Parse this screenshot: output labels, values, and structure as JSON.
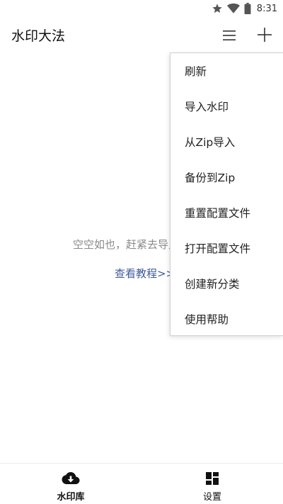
{
  "status_bar": {
    "time": "8:31",
    "icons": [
      "star-icon",
      "wifi-icon",
      "battery-icon"
    ]
  },
  "app_bar": {
    "title": "水印大法",
    "menu_icon": "list-menu-icon",
    "add_icon": "plus-icon"
  },
  "empty_state": {
    "message": "空空如也，赶紧去导入",
    "tutorial_link": "查看教程>>"
  },
  "dropdown": {
    "items": [
      "刷新",
      "导入水印",
      "从Zip导入",
      "备份到Zip",
      "重置配置文件",
      "打开配置文件",
      "创建新分类",
      "使用帮助"
    ]
  },
  "bottom_nav": {
    "items": [
      {
        "label": "水印库",
        "icon": "cloud-download-icon",
        "active": true
      },
      {
        "label": "设置",
        "icon": "dashboard-icon",
        "active": false
      }
    ]
  },
  "colors": {
    "link": "#3d5a98",
    "muted_text": "#8a8a8a",
    "divider": "#ececec"
  }
}
